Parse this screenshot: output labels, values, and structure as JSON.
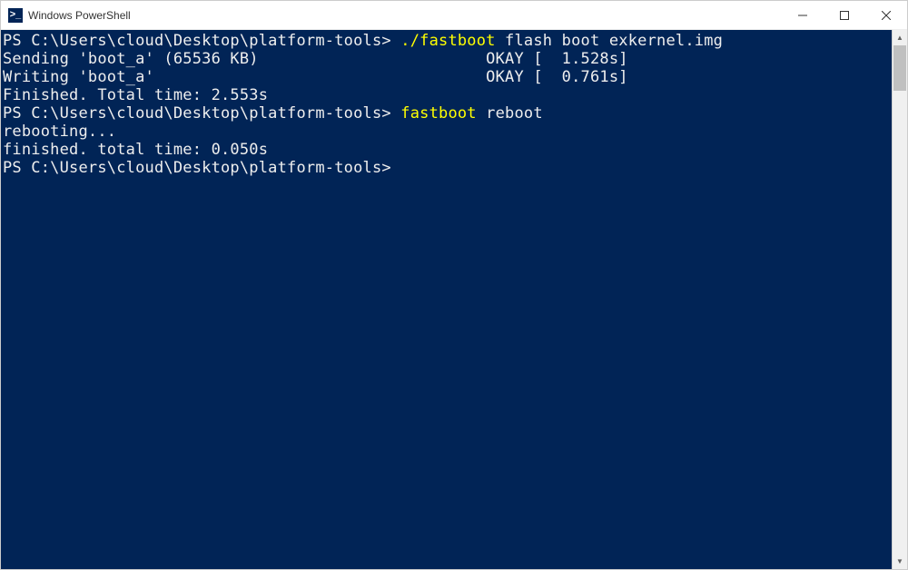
{
  "window": {
    "title": "Windows PowerShell"
  },
  "terminal": {
    "lines": [
      {
        "segments": [
          {
            "cls": "white",
            "text": "PS C:\\Users\\cloud\\Desktop\\platform-tools> "
          },
          {
            "cls": "yellow",
            "text": "./fastboot"
          },
          {
            "cls": "white",
            "text": " flash boot exkernel.img"
          }
        ]
      },
      {
        "segments": [
          {
            "cls": "white",
            "text": "Sending 'boot_a' (65536 KB)                        OKAY [  1.528s]"
          }
        ]
      },
      {
        "segments": [
          {
            "cls": "white",
            "text": "Writing 'boot_a'                                   OKAY [  0.761s]"
          }
        ]
      },
      {
        "segments": [
          {
            "cls": "white",
            "text": "Finished. Total time: 2.553s"
          }
        ]
      },
      {
        "segments": [
          {
            "cls": "white",
            "text": "PS C:\\Users\\cloud\\Desktop\\platform-tools> "
          },
          {
            "cls": "yellow",
            "text": "fastboot"
          },
          {
            "cls": "white",
            "text": " reboot"
          }
        ]
      },
      {
        "segments": [
          {
            "cls": "white",
            "text": "rebooting..."
          }
        ]
      },
      {
        "segments": [
          {
            "cls": "white",
            "text": ""
          }
        ]
      },
      {
        "segments": [
          {
            "cls": "white",
            "text": "finished. total time: 0.050s"
          }
        ]
      },
      {
        "segments": [
          {
            "cls": "white",
            "text": "PS C:\\Users\\cloud\\Desktop\\platform-tools>"
          }
        ]
      }
    ]
  }
}
